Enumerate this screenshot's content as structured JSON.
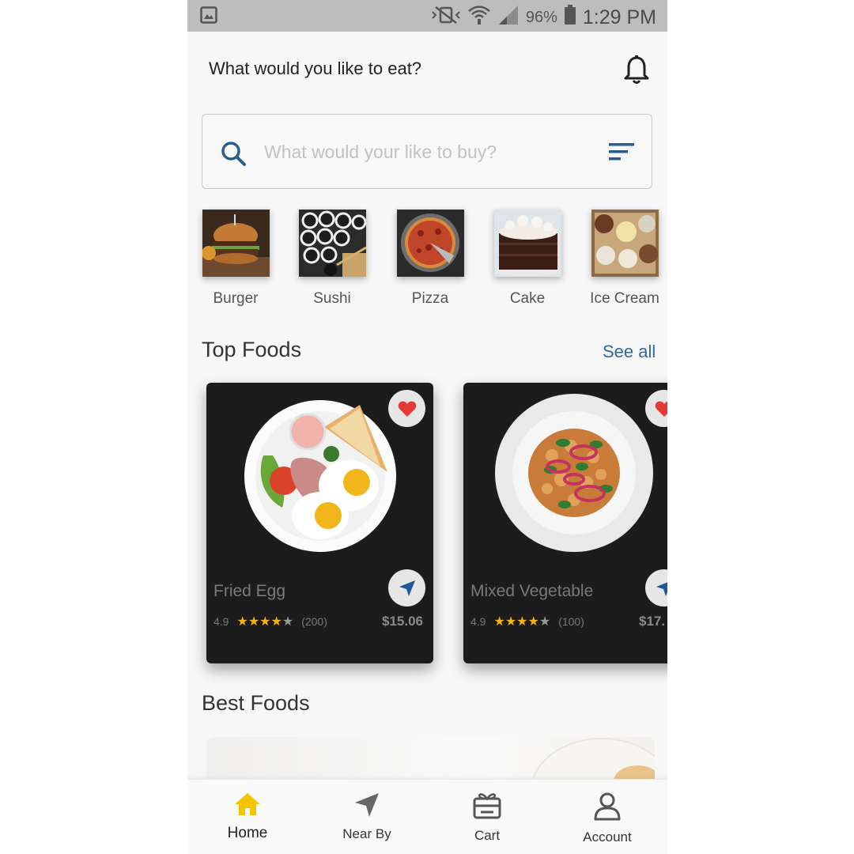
{
  "status_bar": {
    "battery": "96%",
    "time": "1:29 PM"
  },
  "header": {
    "greeting": "What would you like to eat?"
  },
  "search": {
    "placeholder": "What would your like to buy?"
  },
  "categories": [
    {
      "label": "Burger"
    },
    {
      "label": "Sushi"
    },
    {
      "label": "Pizza"
    },
    {
      "label": "Cake"
    },
    {
      "label": "Ice Cream"
    }
  ],
  "top_foods": {
    "title": "Top Foods",
    "see_all": "See all",
    "items": [
      {
        "name": "Fried Egg",
        "rating": "4.9",
        "reviews": "(200)",
        "price": "$15.06",
        "stars": 4,
        "favorite": true
      },
      {
        "name": "Mixed Vegetable",
        "rating": "4.9",
        "reviews": "(100)",
        "price": "$17.",
        "stars": 4,
        "favorite": true
      }
    ]
  },
  "best_foods": {
    "title": "Best Foods"
  },
  "bottom_nav": [
    {
      "label": "Home",
      "active": true
    },
    {
      "label": "Near By"
    },
    {
      "label": "Cart"
    },
    {
      "label": "Account"
    }
  ],
  "colors": {
    "accent": "#2e6aa1",
    "active_nav": "#f5c400",
    "heart": "#e53935",
    "star": "#f3b413",
    "card_bg": "#1c1c1c"
  }
}
